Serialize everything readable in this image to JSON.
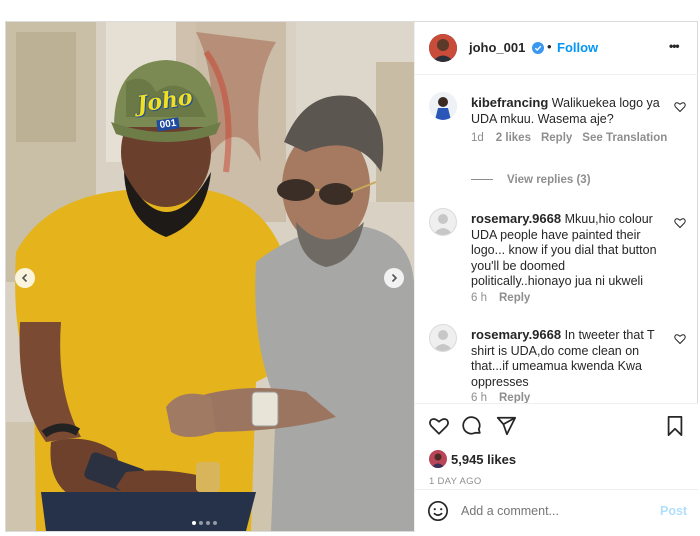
{
  "post": {
    "username": "joho_001",
    "follow_label": "Follow",
    "more_label": "•••"
  },
  "comments": [
    {
      "username": "kibefrancing",
      "text": "Walikuekea logo ya UDA mkuu. Wasema aje?",
      "time": "1d",
      "likes": "2 likes",
      "reply": "Reply",
      "translate": "See Translation"
    },
    {
      "username": "rosemary.9668",
      "text": "Mkuu,hio colour UDA people have painted their logo... know if you dial that button you'll be doomed politically..hionayo jua ni ukweli",
      "time": "6 h",
      "reply": "Reply"
    },
    {
      "username": "rosemary.9668",
      "text": "In tweeter that T shirt is UDA,do come clean on that...if umeamua kwenda Kwa oppresses",
      "time": "6 h",
      "reply": "Reply"
    }
  ],
  "view_replies": "View replies (3)",
  "likes_count": "5,945 likes",
  "post_age": "1 DAY AGO",
  "add_comment_placeholder": "Add a comment...",
  "post_button": "Post",
  "cap_text": "Joho",
  "cap_number": "001",
  "carousel": {
    "total": 4,
    "active_index": 0
  },
  "colors": {
    "accent": "#0095f6",
    "verified": "#3897f0",
    "shirt": "#e8b820",
    "cap_text": "#f0e020"
  }
}
